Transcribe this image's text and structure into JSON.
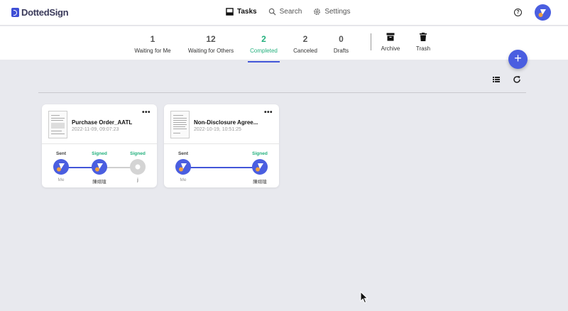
{
  "app": {
    "logo_text": "DottedSign"
  },
  "nav": {
    "items": [
      {
        "label": "Tasks",
        "icon": "inbox-icon",
        "active": true
      },
      {
        "label": "Search",
        "icon": "search-icon",
        "active": false
      },
      {
        "label": "Settings",
        "icon": "gear-icon",
        "active": false
      }
    ],
    "help_icon": "question-icon"
  },
  "status_tabs": [
    {
      "count": "1",
      "label": "Waiting for Me"
    },
    {
      "count": "12",
      "label": "Waiting for Others"
    },
    {
      "count": "2",
      "label": "Completed",
      "active": true
    },
    {
      "count": "2",
      "label": "Canceled"
    },
    {
      "count": "0",
      "label": "Drafts"
    }
  ],
  "archive_tabs": [
    {
      "label": "Archive",
      "icon": "archive-box-icon"
    },
    {
      "label": "Trash",
      "icon": "trash-icon"
    }
  ],
  "fab": {
    "label": "+"
  },
  "colors": {
    "accent": "#4356d8",
    "signed": "#23b07d",
    "avatar": "#4a5ee0",
    "dot": "#f0a040"
  },
  "cards": [
    {
      "title": "Purchase Order_AATL",
      "date": "2022-11-09, 09:07:23",
      "menu": "•••",
      "steps": [
        {
          "status": "Sent",
          "name": "Me",
          "state": "done"
        },
        {
          "status": "Signed",
          "name": "陳翊瑄",
          "state": "done"
        },
        {
          "status": "Signed",
          "name": "j",
          "state": "inactive"
        }
      ]
    },
    {
      "title": "Non-Disclosure Agree...",
      "date": "2022-10-19, 10:51:25",
      "menu": "•••",
      "steps": [
        {
          "status": "Sent",
          "name": "Me",
          "state": "done"
        },
        {
          "status": "Signed",
          "name": "陳翊瑄",
          "state": "done"
        }
      ]
    }
  ]
}
